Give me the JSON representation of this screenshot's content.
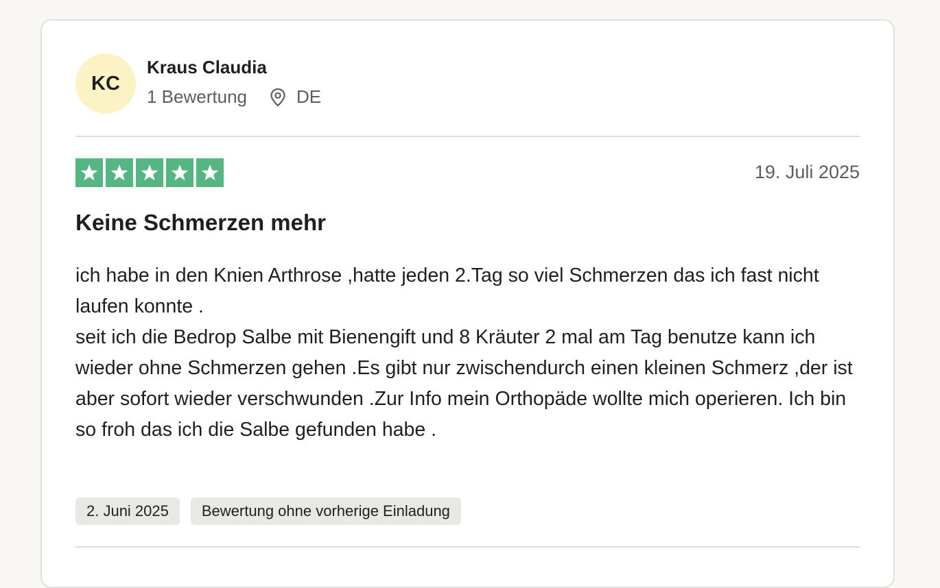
{
  "reviewer": {
    "initials": "KC",
    "name": "Kraus Claudia",
    "review_count": "1 Bewertung",
    "country": "DE"
  },
  "review": {
    "rating": 5,
    "rating_max": 5,
    "date": "19. Juli 2025",
    "title": "Keine Schmerzen mehr",
    "body_paragraphs": [
      "ich habe in den Knien Arthrose ,hatte jeden 2.Tag so viel Schmerzen das ich fast nicht laufen konnte .",
      "seit ich die Bedrop Salbe mit Bienengift und 8 Kräuter 2 mal am Tag benutze kann ich wieder ohne Schmerzen gehen .Es gibt nur zwischendurch einen kleinen Schmerz ,der ist aber sofort wieder verschwunden .Zur Info mein Orthopäde wollte mich operieren. Ich bin so froh das ich die Salbe gefunden habe ."
    ],
    "tags": [
      "2. Juni 2025",
      "Bewertung ohne vorherige Einladung"
    ]
  },
  "colors": {
    "avatar_bg": "#fcf3c5",
    "star_green": "#55b683",
    "tag_bg": "#e9e8e5"
  },
  "icons": {
    "location": "location-pin-icon",
    "star": "star-icon"
  }
}
